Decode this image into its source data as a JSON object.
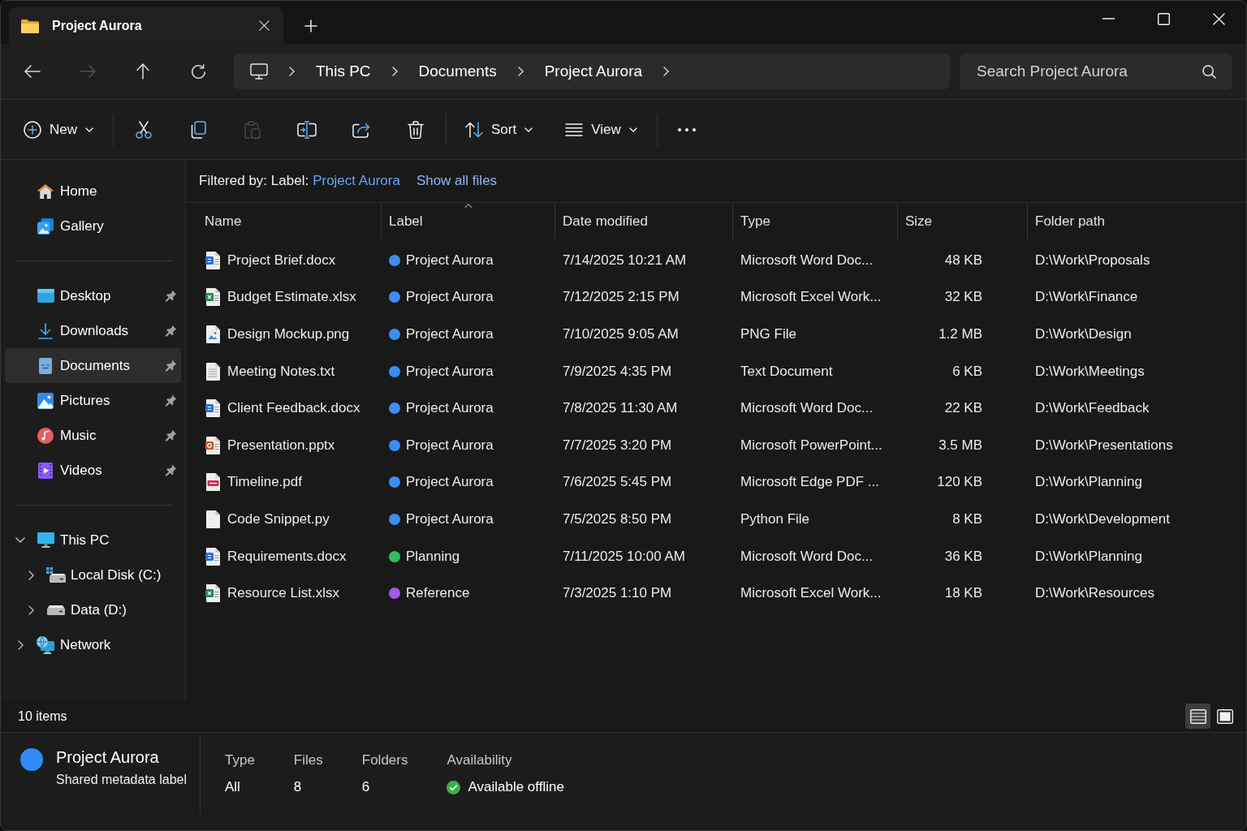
{
  "tabs": [
    {
      "title": "Project Aurora",
      "selected": true
    }
  ],
  "navigation": [
    {
      "kind": "back",
      "disabled": false
    },
    {
      "kind": "forward",
      "disabled": true
    },
    {
      "kind": "up",
      "disabled": false
    },
    {
      "kind": "refresh",
      "disabled": false
    }
  ],
  "breadcrumb": [
    "This PC",
    "Documents",
    "Project Aurora"
  ],
  "search": {
    "placeholder": "Search Project Aurora"
  },
  "command_bar": [
    {
      "kind": "new",
      "label": "New",
      "dropdown": true,
      "disabled": false
    },
    {
      "kind": "separator"
    },
    {
      "kind": "cut",
      "dropdown": false,
      "disabled": false
    },
    {
      "kind": "copy",
      "dropdown": false,
      "disabled": false
    },
    {
      "kind": "paste",
      "dropdown": false,
      "disabled": true
    },
    {
      "kind": "rename",
      "dropdown": false,
      "disabled": false
    },
    {
      "kind": "share",
      "dropdown": false,
      "disabled": false
    },
    {
      "kind": "delete",
      "dropdown": false,
      "disabled": false
    },
    {
      "kind": "separator"
    },
    {
      "kind": "sort",
      "label": "Sort",
      "dropdown": true,
      "disabled": false
    },
    {
      "kind": "view",
      "label": "View",
      "dropdown": true,
      "disabled": false
    },
    {
      "kind": "separator"
    },
    {
      "kind": "more",
      "dropdown": false,
      "disabled": false
    }
  ],
  "sidebar": {
    "sections": [
      {
        "items": [
          {
            "kind": "home",
            "label": "Home",
            "pinned": false,
            "selected": false
          },
          {
            "kind": "gallery",
            "label": "Gallery",
            "pinned": false,
            "selected": false
          }
        ]
      },
      {
        "items": [
          {
            "kind": "desktop",
            "label": "Desktop",
            "pinned": true,
            "selected": false
          },
          {
            "kind": "downloads",
            "label": "Downloads",
            "pinned": true,
            "selected": false
          },
          {
            "kind": "documents",
            "label": "Documents",
            "pinned": true,
            "selected": true
          },
          {
            "kind": "pictures",
            "label": "Pictures",
            "pinned": true,
            "selected": false
          },
          {
            "kind": "music",
            "label": "Music",
            "pinned": true,
            "selected": false
          },
          {
            "kind": "videos",
            "label": "Videos",
            "pinned": true,
            "selected": false
          }
        ]
      },
      {
        "items": [
          {
            "kind": "pc",
            "label": "This PC",
            "expanded": true,
            "selected": false,
            "children": [
              {
                "kind": "system_drive",
                "label": "Local Disk (C:)",
                "expanded": false,
                "selected": false
              },
              {
                "kind": "drive",
                "label": "Data (D:)",
                "expanded": false,
                "selected": false
              }
            ]
          },
          {
            "kind": "network",
            "label": "Network",
            "expanded": false,
            "selected": false
          }
        ]
      }
    ]
  },
  "filter": {
    "label": "Filtered by: Label:",
    "value": "Project Aurora",
    "action": "Show all files"
  },
  "table": {
    "columns": [
      {
        "title": "Name",
        "sorted": false
      },
      {
        "title": "Label",
        "sorted": true
      },
      {
        "title": "Date modified",
        "sorted": false
      },
      {
        "title": "Type",
        "sorted": false
      },
      {
        "title": "Size",
        "sorted": false
      },
      {
        "title": "Folder path",
        "sorted": false
      }
    ],
    "rows": [
      {
        "kind": "word",
        "name": "Project Brief.docx",
        "label": "Project Aurora",
        "color": "#3b8ef0",
        "date": "7/14/2025 10:21 AM",
        "type": "Microsoft Word Doc...",
        "size": "48 KB",
        "path": "D:\\Work\\Proposals"
      },
      {
        "kind": "excel",
        "name": "Budget Estimate.xlsx",
        "label": "Project Aurora",
        "color": "#3b8ef0",
        "date": "7/12/2025 2:15 PM",
        "type": "Microsoft Excel Work...",
        "size": "32 KB",
        "path": "D:\\Work\\Finance"
      },
      {
        "kind": "image",
        "name": "Design Mockup.png",
        "label": "Project Aurora",
        "color": "#3b8ef0",
        "date": "7/10/2025 9:05 AM",
        "type": "PNG File",
        "size": "1.2 MB",
        "path": "D:\\Work\\Design"
      },
      {
        "kind": "text",
        "name": "Meeting Notes.txt",
        "label": "Project Aurora",
        "color": "#3b8ef0",
        "date": "7/9/2025 4:35 PM",
        "type": "Text Document",
        "size": "6 KB",
        "path": "D:\\Work\\Meetings"
      },
      {
        "kind": "word",
        "name": "Client Feedback.docx",
        "label": "Project Aurora",
        "color": "#3b8ef0",
        "date": "7/8/2025 11:30 AM",
        "type": "Microsoft Word Doc...",
        "size": "22 KB",
        "path": "D:\\Work\\Feedback"
      },
      {
        "kind": "powerpoint",
        "name": "Presentation.pptx",
        "label": "Project Aurora",
        "color": "#3b8ef0",
        "date": "7/7/2025 3:20 PM",
        "type": "Microsoft PowerPoint...",
        "size": "3.5 MB",
        "path": "D:\\Work\\Presentations"
      },
      {
        "kind": "pdf",
        "name": "Timeline.pdf",
        "label": "Project Aurora",
        "color": "#3b8ef0",
        "date": "7/6/2025 5:45 PM",
        "type": "Microsoft Edge PDF ...",
        "size": "120 KB",
        "path": "D:\\Work\\Planning"
      },
      {
        "kind": "code",
        "name": "Code Snippet.py",
        "label": "Project Aurora",
        "color": "#3b8ef0",
        "date": "7/5/2025 8:50 PM",
        "type": "Python File",
        "size": "8 KB",
        "path": "D:\\Work\\Development"
      },
      {
        "kind": "word",
        "name": "Requirements.docx",
        "label": "Planning",
        "color": "#2fbf5c",
        "date": "7/11/2025 10:00 AM",
        "type": "Microsoft Word Doc...",
        "size": "36 KB",
        "path": "D:\\Work\\Planning"
      },
      {
        "kind": "excel",
        "name": "Resource List.xlsx",
        "label": "Reference",
        "color": "#a45ae6",
        "date": "7/3/2025 1:10 PM",
        "type": "Microsoft Excel Work...",
        "size": "18 KB",
        "path": "D:\\Work\\Resources"
      }
    ]
  },
  "status": {
    "item_count": "10 items"
  },
  "view_toggles": [
    {
      "kind": "details",
      "selected": true
    },
    {
      "kind": "tiles",
      "selected": false
    }
  ],
  "details": {
    "title": "Project Aurora",
    "subtitle": "Shared metadata label",
    "properties": [
      {
        "kind": "text",
        "label": "Type",
        "value": "All"
      },
      {
        "kind": "text",
        "label": "Files",
        "value": "8"
      },
      {
        "kind": "text",
        "label": "Folders",
        "value": "6"
      },
      {
        "kind": "availability",
        "label": "Availability",
        "value": "Available offline"
      }
    ]
  }
}
